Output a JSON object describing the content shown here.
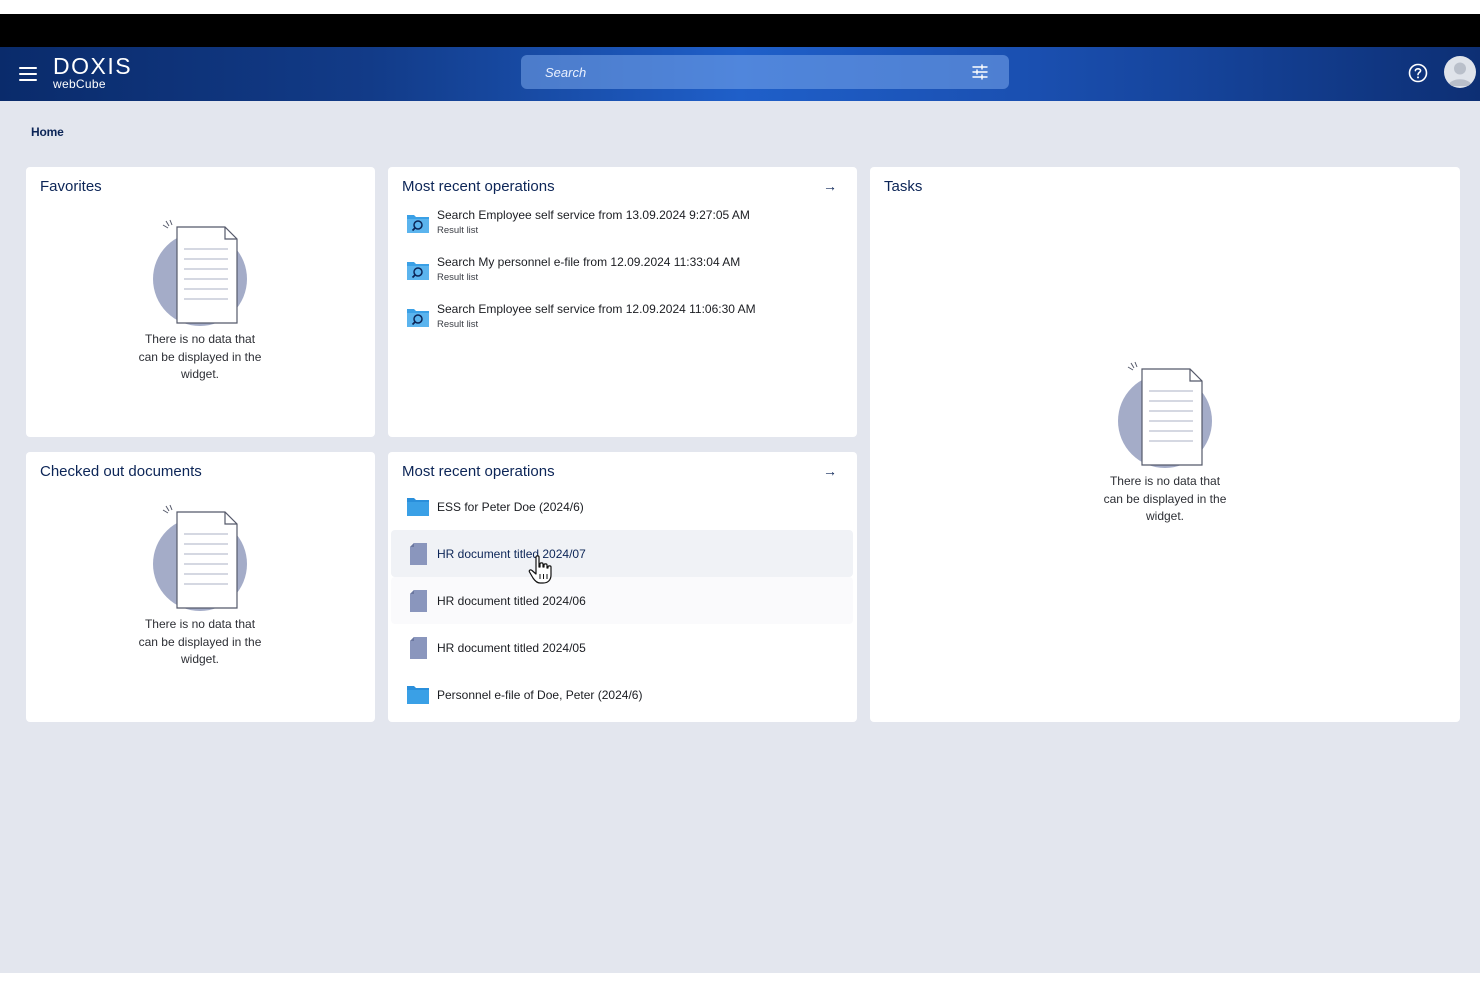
{
  "header": {
    "logo_line1": "DOXIS",
    "logo_line2": "webCube",
    "search_placeholder": "Search"
  },
  "breadcrumb": "Home",
  "empty_text": "There is no data that can be displayed in the widget.",
  "widgets": {
    "favorites": {
      "title": "Favorites"
    },
    "checked_out": {
      "title": "Checked out documents"
    },
    "tasks": {
      "title": "Tasks"
    },
    "recent_searches": {
      "title": "Most recent operations",
      "items": [
        {
          "label": "Search Employee self service from 13.09.2024 9:27:05 AM",
          "sub": "Result list",
          "icon": "saved-search-icon"
        },
        {
          "label": "Search My personnel e-file from 12.09.2024 11:33:04 AM",
          "sub": "Result list",
          "icon": "saved-search-icon"
        },
        {
          "label": "Search Employee self service from 12.09.2024 11:06:30 AM",
          "sub": "Result list",
          "icon": "saved-search-icon"
        }
      ]
    },
    "recent_documents": {
      "title": "Most recent operations",
      "items": [
        {
          "label": "ESS for Peter Doe (2024/6)",
          "icon": "folder-icon"
        },
        {
          "label": "HR document titled 2024/07",
          "icon": "document-icon"
        },
        {
          "label": "HR document titled 2024/06",
          "icon": "document-icon"
        },
        {
          "label": "HR document titled 2024/05",
          "icon": "document-icon"
        },
        {
          "label": "Personnel e-file of Doe, Peter (2024/6)",
          "icon": "folder-icon"
        }
      ]
    }
  },
  "colors": {
    "accent": "#0c2557",
    "background": "#e3e6ee",
    "folder": "#3aa0e6",
    "document": "#8a96bd"
  }
}
